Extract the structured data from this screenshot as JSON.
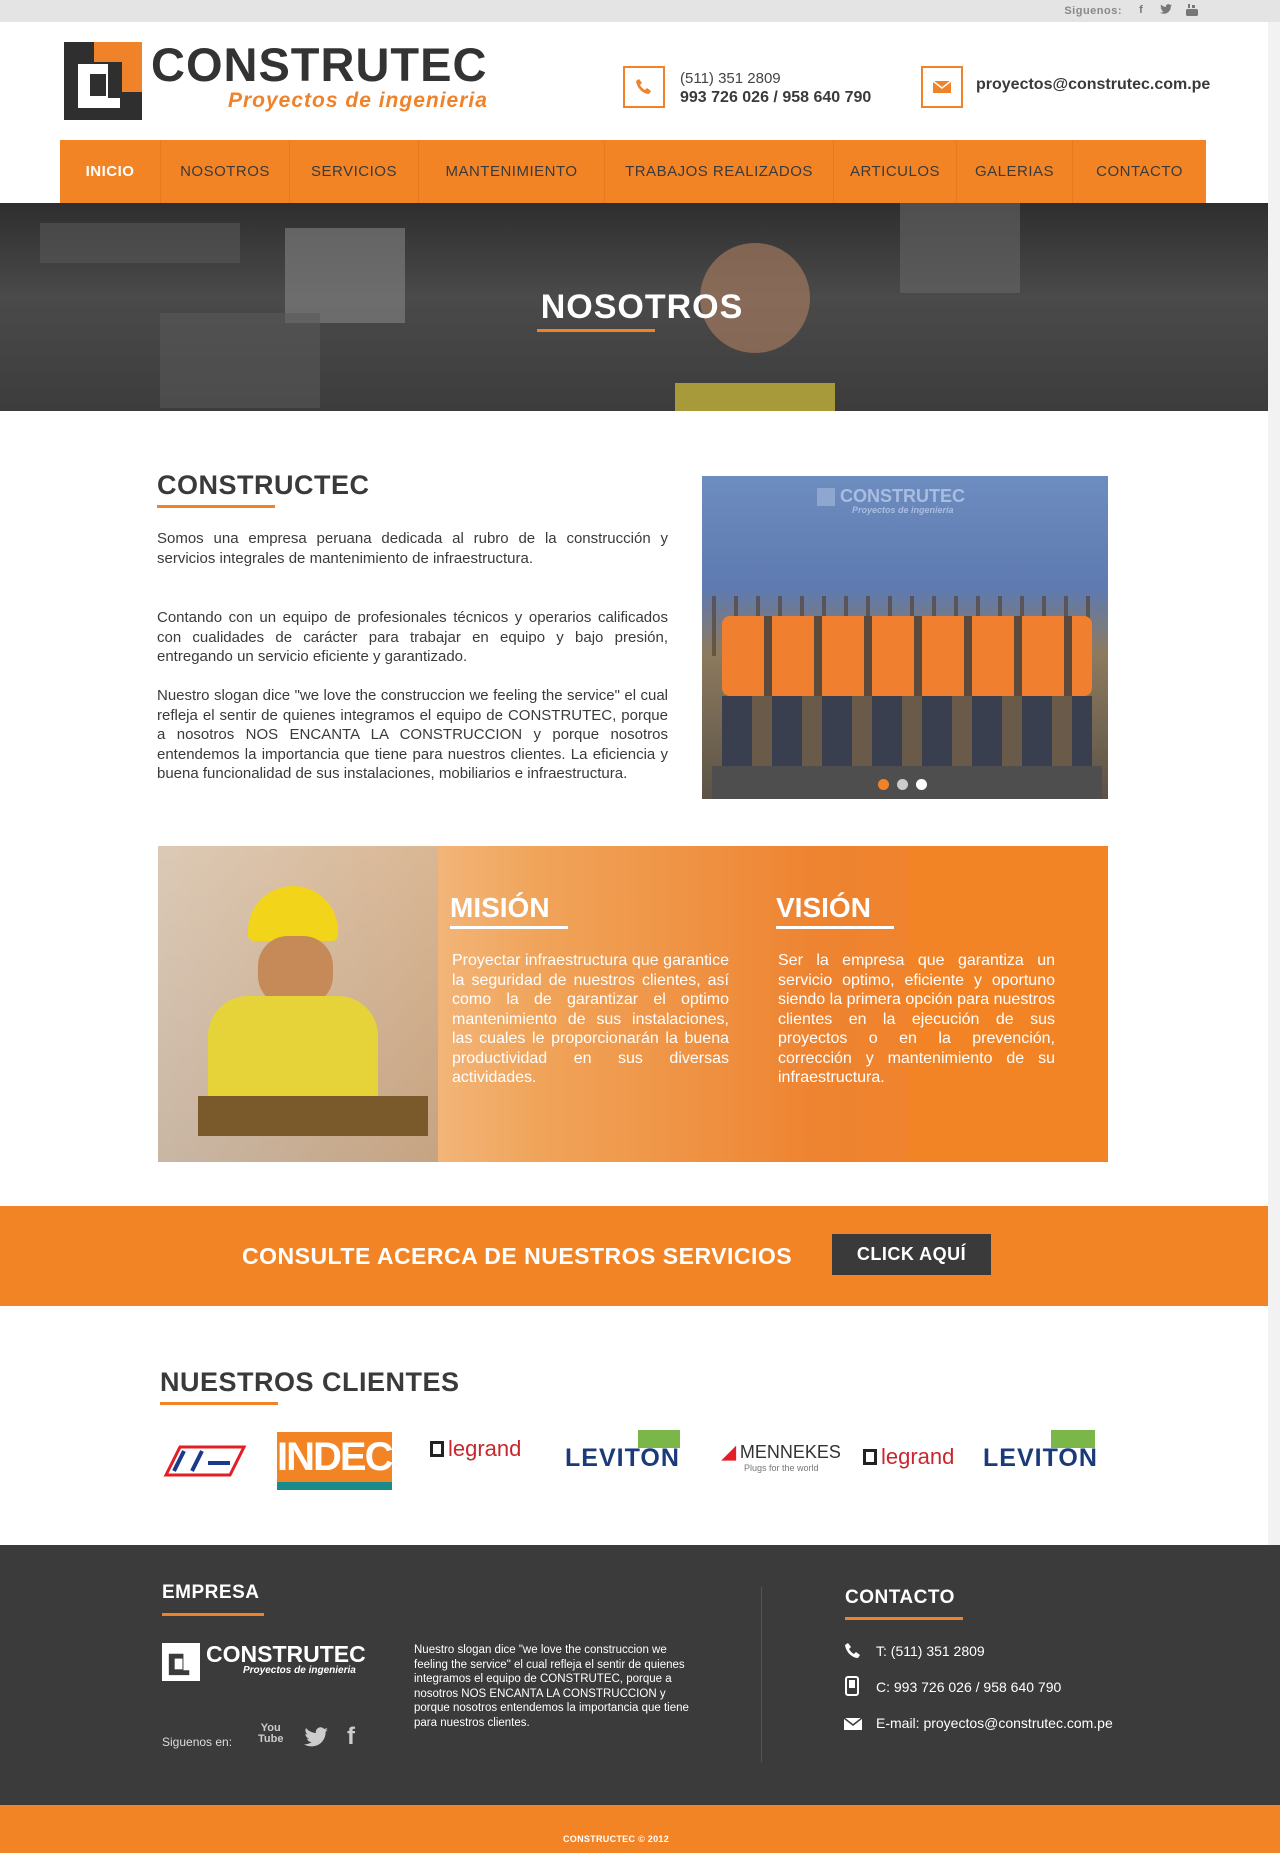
{
  "topbar": {
    "follow_label": "Siguenos:",
    "social": [
      "facebook-icon",
      "twitter-icon",
      "youtube-icon"
    ]
  },
  "header": {
    "logo_title": "CONSTRUTEC",
    "logo_subtitle": "Proyectos de ingenieria",
    "phone_line1": "(511) 351 2809",
    "phone_line2": "993 726 026 / 958 640 790",
    "email": "proyectos@construtec.com.pe"
  },
  "nav": {
    "items": [
      {
        "label": "INICIO",
        "active": true
      },
      {
        "label": "NOSOTROS"
      },
      {
        "label": "SERVICIOS"
      },
      {
        "label": "MANTENIMIENTO"
      },
      {
        "label": "TRABAJOS REALIZADOS"
      },
      {
        "label": "ARTICULOS"
      },
      {
        "label": "GALERIAS"
      },
      {
        "label": "CONTACTO"
      }
    ]
  },
  "hero": {
    "title": "NOSOTROS"
  },
  "about": {
    "heading": "CONSTRUCTEC",
    "p1": "Somos una empresa peruana dedicada al rubro de la construcción y servicios integrales de mantenimiento de infraestructura.",
    "p2": "Contando con un equipo de profesionales técnicos y operarios calificados con cualidades de carácter para trabajar en equipo y bajo presión, entregando un servicio eficiente y garantizado.",
    "p3": "Nuestro slogan dice \"we love the construccion we feeling the service\" el cual refleja el sentir de quienes integramos el equipo de CONSTRUTEC, porque a nosotros NOS ENCANTA LA CONSTRUCCION y porque nosotros entendemos la importancia que tiene para nuestros clientes. La eficiencia y buena funcionalidad de sus instalaciones, mobiliarios e infraestructura.",
    "photo_logo": "CONSTRUTEC",
    "photo_logo_sub": "Proyectos de ingenieria"
  },
  "mission": {
    "title": "MISIÓN",
    "text": "Proyectar infraestructura que garantice la seguridad de nuestros clientes, así como la de garantizar el optimo mantenimiento de sus instalaciones, las cuales le proporcionarán la buena productividad en sus diversas actividades."
  },
  "vision": {
    "title": "VISIÓN",
    "text": "Ser la empresa que garantiza un servicio optimo, eficiente y oportuno siendo la primera opción para nuestros clientes en la ejecución de sus proyectos o en la prevención, corrección y mantenimiento de su infraestructura."
  },
  "cta": {
    "text": "CONSULTE ACERCA DE NUESTROS SERVICIOS",
    "button": "CLICK AQUÍ"
  },
  "clients": {
    "heading": "NUESTROS CLIENTES",
    "logos": [
      "INDECO",
      "legrand",
      "LEVITON",
      "MENNEKES",
      "Plugs for the world",
      "legrand",
      "LEVITON"
    ]
  },
  "footer": {
    "empresa_heading": "EMPRESA",
    "logo_title": "CONSTRUTEC",
    "logo_subtitle": "Proyectos de ingenieria",
    "text": "Nuestro slogan dice \"we love the construccion we feeling the service\" el cual refleja el sentir de quienes integramos el equipo de CONSTRUTEC, porque a nosotros NOS ENCANTA LA CONSTRUCCION y porque nosotros entendemos la importancia que tiene para nuestros clientes.",
    "follow_label": "Siguenos en:",
    "contacto_heading": "CONTACTO",
    "tel": "T: (511) 351 2809",
    "cel": "C: 993 726 026 / 958 640 790",
    "email": "E-mail: proyectos@construtec.com.pe",
    "copyright": "CONSTRUCTEC © 2012"
  },
  "colors": {
    "accent": "#f38426",
    "dark": "#3b3b3b"
  }
}
